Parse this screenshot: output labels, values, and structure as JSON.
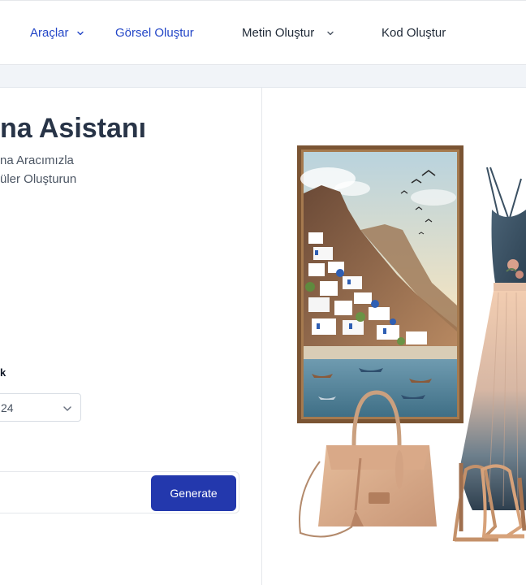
{
  "nav": {
    "items": [
      {
        "label": "Araçlar",
        "has_dropdown": true,
        "color": "#2346c7"
      },
      {
        "label": "Görsel Oluştur",
        "has_dropdown": false,
        "color": "#2346c7"
      },
      {
        "label": "Metin Oluştur",
        "has_dropdown": true,
        "color": "#1f2937"
      },
      {
        "label": "Kod Oluştur",
        "has_dropdown": false,
        "color": "#1f2937"
      }
    ]
  },
  "main": {
    "title": "na Asistanı",
    "subtitle_line1": "na Aracımızla",
    "subtitle_line2": "üler Oluşturun"
  },
  "form": {
    "field_label": "k",
    "select_value": "24",
    "prompt_value": "",
    "generate_label": "Generate"
  },
  "preview": {
    "image_subject": "painting of a cliffside white village with harbor boats beside a blue-and-peach ombré dress, beige handbag and strappy heels"
  },
  "colors": {
    "accent": "#2346c7",
    "button": "#2338ad",
    "band": "#f1f4f8"
  }
}
